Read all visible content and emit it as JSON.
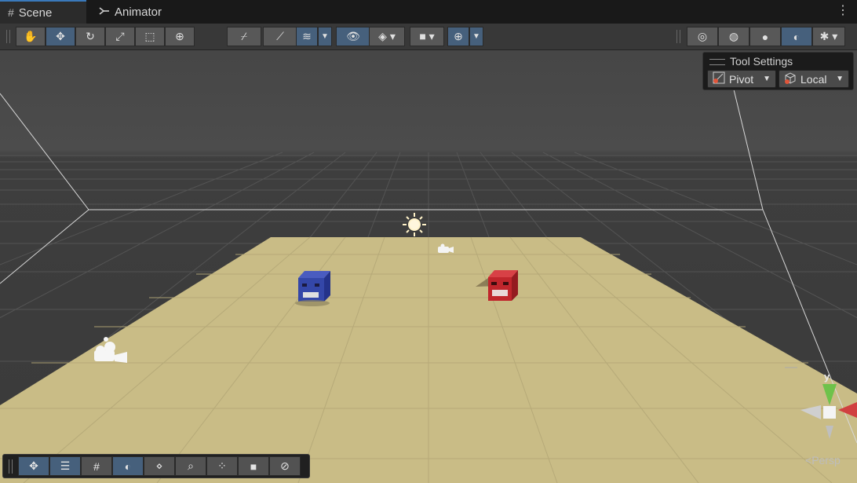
{
  "tabs": {
    "scene": "Scene",
    "animator": "Animator",
    "scene_icon": "grid-icon",
    "animator_icon": "animator-icon"
  },
  "tool_settings": {
    "title": "Tool Settings",
    "pivot": "Pivot",
    "local": "Local"
  },
  "gizmo": {
    "axis_y": "y",
    "persp": "Persp"
  },
  "colors": {
    "accent": "#46607c",
    "floor": "#c9bc86",
    "blue_cube": "#3447a8",
    "red_cube": "#c0262c",
    "sky": "#474747"
  }
}
